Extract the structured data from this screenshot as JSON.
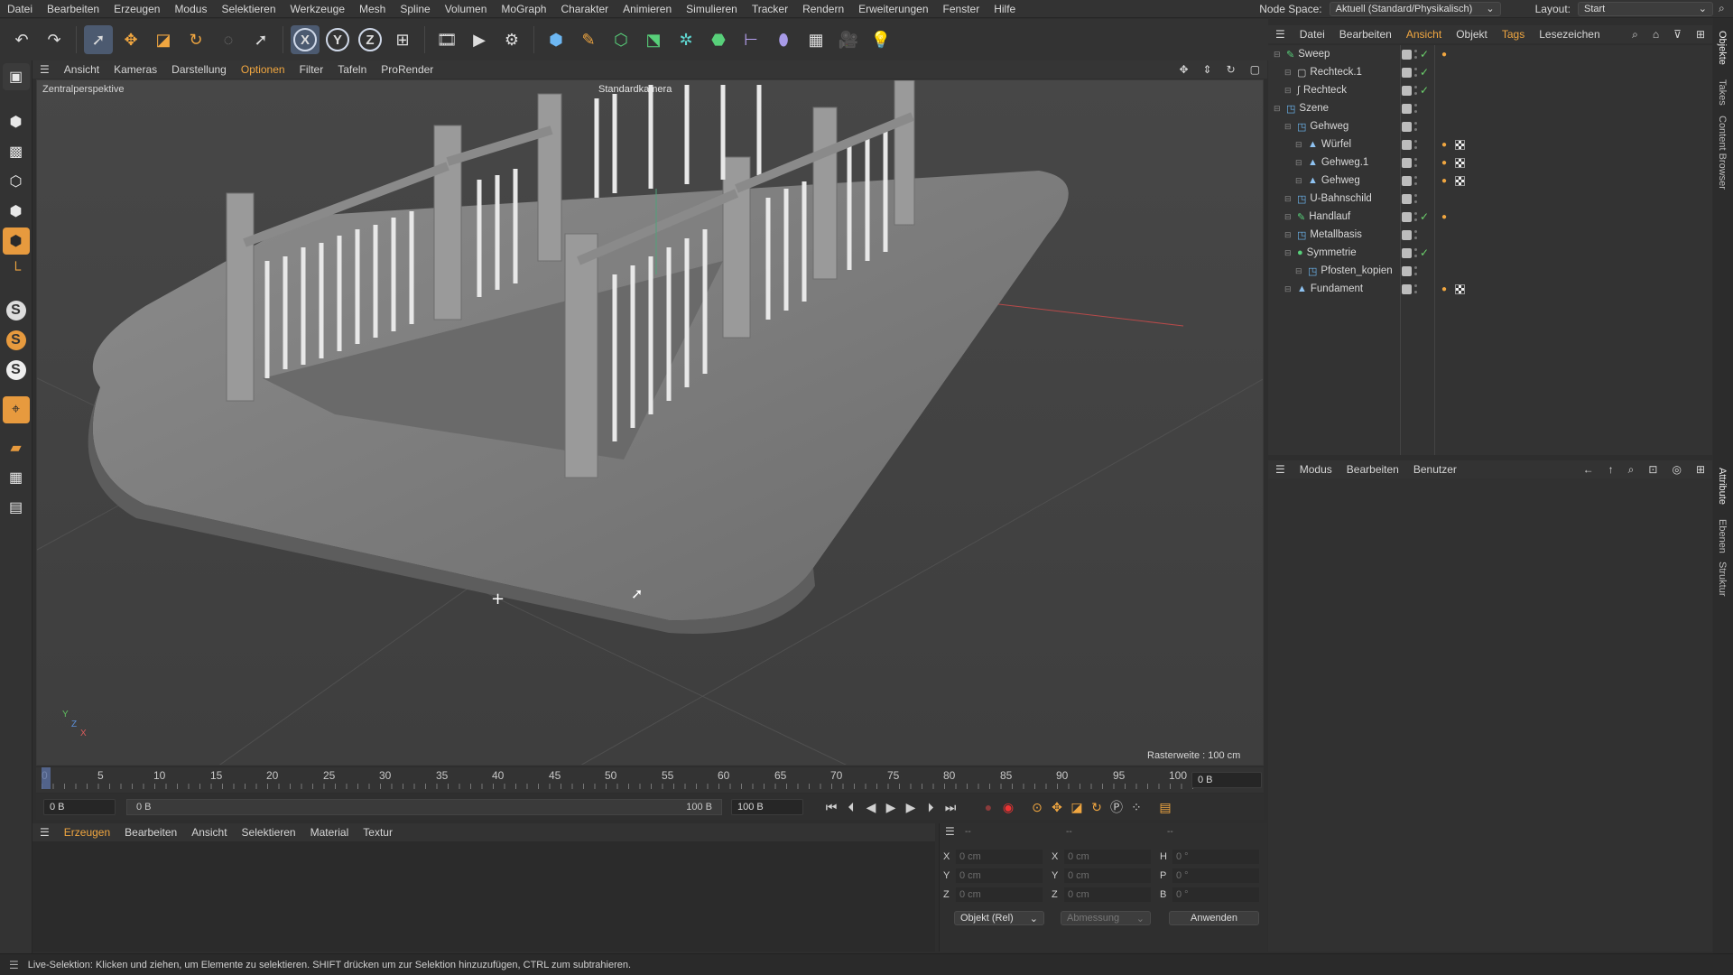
{
  "menubar": {
    "items": [
      "Datei",
      "Bearbeiten",
      "Erzeugen",
      "Modus",
      "Selektieren",
      "Werkzeuge",
      "Mesh",
      "Spline",
      "Volumen",
      "MoGraph",
      "Charakter",
      "Animieren",
      "Simulieren",
      "Tracker",
      "Rendern",
      "Erweiterungen",
      "Fenster",
      "Hilfe"
    ],
    "node_space_label": "Node Space:",
    "node_space_value": "Aktuell (Standard/Physikalisch)",
    "layout_label": "Layout:",
    "layout_value": "Start"
  },
  "viewport": {
    "menu": [
      "Ansicht",
      "Kameras",
      "Darstellung",
      "Optionen",
      "Filter",
      "Tafeln",
      "ProRender"
    ],
    "view_name": "Zentralperspektive",
    "camera_name": "Standardkamera",
    "grid_label": "Rasterweite : 100 cm",
    "axis": {
      "y": "Y",
      "z": "Z",
      "x": "X"
    }
  },
  "timeline": {
    "ticks": [
      "0",
      "5",
      "10",
      "15",
      "20",
      "25",
      "30",
      "35",
      "40",
      "45",
      "50",
      "55",
      "60",
      "65",
      "70",
      "75",
      "80",
      "85",
      "90",
      "95",
      "100"
    ],
    "current_frame": "0 B",
    "start": "0 B",
    "range_start": "0 B",
    "range_end": "100 B",
    "end": "100 B"
  },
  "material": {
    "menu": [
      "Erzeugen",
      "Bearbeiten",
      "Ansicht",
      "Selektieren",
      "Material",
      "Textur"
    ]
  },
  "coordinates": {
    "headers": [
      "--",
      "--",
      "--"
    ],
    "rows": [
      {
        "a": "X",
        "av": "0 cm",
        "b": "X",
        "bv": "0 cm",
        "c": "H",
        "cv": "0 °"
      },
      {
        "a": "Y",
        "av": "0 cm",
        "b": "Y",
        "bv": "0 cm",
        "c": "P",
        "cv": "0 °"
      },
      {
        "a": "Z",
        "av": "0 cm",
        "b": "Z",
        "bv": "0 cm",
        "c": "B",
        "cv": "0 °"
      }
    ],
    "mode": "Objekt (Rel)",
    "size": "Abmessung",
    "apply": "Anwenden"
  },
  "object_manager": {
    "menu": [
      "Datei",
      "Bearbeiten",
      "Ansicht",
      "Objekt",
      "Tags",
      "Lesezeichen"
    ],
    "objects": [
      {
        "name": "Sweep",
        "indent": 0,
        "icon": "sweep-icon",
        "check": true,
        "tags": "orange"
      },
      {
        "name": "Rechteck.1",
        "indent": 1,
        "icon": "rectangle-icon",
        "check": true,
        "tags": ""
      },
      {
        "name": "Rechteck",
        "indent": 1,
        "icon": "spline-icon",
        "check": true,
        "tags": ""
      },
      {
        "name": "Szene",
        "indent": 0,
        "icon": "null-icon",
        "check": false,
        "tags": ""
      },
      {
        "name": "Gehweg",
        "indent": 1,
        "icon": "null-icon",
        "check": false,
        "tags": ""
      },
      {
        "name": "Würfel",
        "indent": 2,
        "icon": "polygon-icon",
        "check": false,
        "tags": "both"
      },
      {
        "name": "Gehweg.1",
        "indent": 2,
        "icon": "polygon-icon",
        "check": false,
        "tags": "both"
      },
      {
        "name": "Gehweg",
        "indent": 2,
        "icon": "polygon-icon",
        "check": false,
        "tags": "both"
      },
      {
        "name": "U-Bahnschild",
        "indent": 1,
        "icon": "null-icon",
        "check": false,
        "tags": ""
      },
      {
        "name": "Handlauf",
        "indent": 1,
        "icon": "sweep-icon",
        "check": true,
        "tags": "orange"
      },
      {
        "name": "Metallbasis",
        "indent": 1,
        "icon": "null-icon",
        "check": false,
        "tags": ""
      },
      {
        "name": "Symmetrie",
        "indent": 1,
        "icon": "symmetry-icon",
        "check": true,
        "tags": ""
      },
      {
        "name": "Pfosten_kopien",
        "indent": 2,
        "icon": "null-icon",
        "check": false,
        "tags": ""
      },
      {
        "name": "Fundament",
        "indent": 1,
        "icon": "polygon-icon",
        "check": false,
        "tags": "both"
      }
    ]
  },
  "attributes": {
    "menu": [
      "Modus",
      "Bearbeiten",
      "Benutzer"
    ]
  },
  "right_tabs": [
    "Objekte",
    "Takes",
    "Content Browser",
    "Attribute",
    "Ebenen",
    "Struktur"
  ],
  "status": "Live-Selektion: Klicken und ziehen, um Elemente zu selektieren. SHIFT drücken um zur Selektion hinzuzufügen, CTRL zum subtrahieren."
}
